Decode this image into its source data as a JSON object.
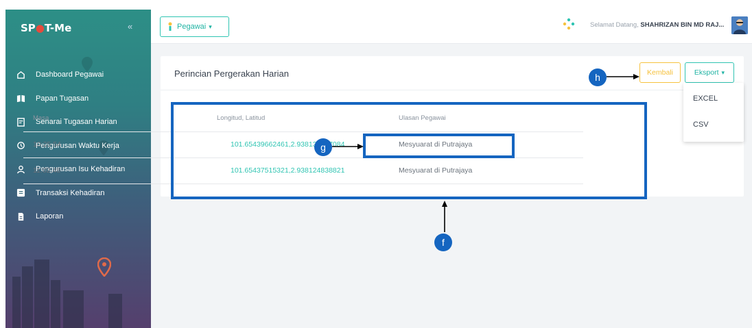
{
  "sidebar": {
    "logo_prefix": "SP",
    "logo_suffix": "T-Me",
    "collapse_icon": "«",
    "items": [
      {
        "label": "Dashboard Pegawai",
        "icon": "home-icon"
      },
      {
        "label": "Papan Tugasan",
        "icon": "book-icon"
      },
      {
        "label": "Senarai Tugasan Harian",
        "icon": "edit-list-icon"
      },
      {
        "label": "Pengurusan Waktu Kerja",
        "icon": "history-icon"
      },
      {
        "label": "Pengurusan Isu Kehadiran",
        "icon": "user-icon"
      },
      {
        "label": "Transaksi Kehadiran",
        "icon": "list-icon"
      },
      {
        "label": "Laporan",
        "icon": "report-icon"
      }
    ]
  },
  "topbar": {
    "role_button": "Pegawai",
    "welcome_text": "Selamat Datang,",
    "user_name": "SHAHRIZAN BIN MD RAJ..."
  },
  "card": {
    "title": "Perincian Pergerakan Harian",
    "back_button": "Kembali",
    "export_button": "Eksport",
    "export_options": [
      "EXCEL",
      "CSV"
    ]
  },
  "table": {
    "headers": [
      "Masa",
      "Longitud, Latitud",
      "Ulasan Pegawai"
    ],
    "rows": [
      {
        "time": "10:25:54",
        "coord": "101.65439662461,2.938136277084",
        "note": "Mesyuarat di Putrajaya"
      },
      {
        "time": "11:02:48",
        "coord": "101.65437515321,2.938124838821",
        "note": "Mesyuarat di Putrajaya"
      }
    ]
  },
  "annotations": {
    "f": "f",
    "g": "g",
    "h": "h",
    "color": "#1565c0"
  },
  "colors": {
    "accent": "#2fc4b2",
    "warning": "#f6c23e"
  }
}
